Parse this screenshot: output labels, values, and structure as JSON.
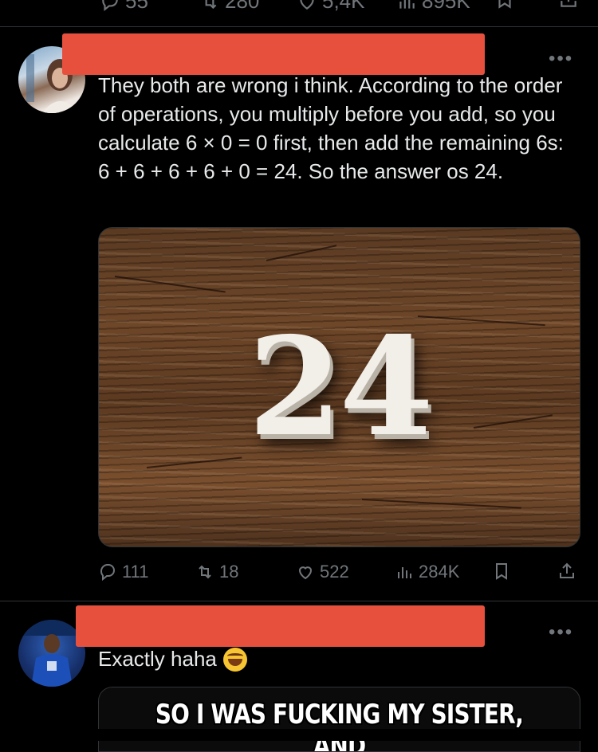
{
  "previous_tweet": {
    "actions": [
      {
        "icon": "reply-icon",
        "label": "55"
      },
      {
        "icon": "retweet-icon",
        "label": "280"
      },
      {
        "icon": "heart-icon",
        "label": "5,4K"
      },
      {
        "icon": "views-icon",
        "label": "895K"
      },
      {
        "icon": "bookmark-icon",
        "label": ""
      },
      {
        "icon": "share-icon",
        "label": ""
      }
    ]
  },
  "tweet": {
    "author_redacted": true,
    "more_label": "•••",
    "text": "They both are wrong i think. According to the order of operations, you multiply before you add, so you calculate 6 × 0 = 0 first, then add the remaining 6s: 6 + 6 + 6 + 6 + 0 = 24. So the answer os 24.",
    "image_number": "24",
    "actions": {
      "replies": "111",
      "retweets": "18",
      "likes": "522",
      "views": "284K"
    }
  },
  "reply": {
    "author_redacted": true,
    "more_label": "•••",
    "text": "Exactly haha",
    "emoji": "rolling-on-floor-laughing",
    "media_caption": "SO I WAS FUCKING MY SISTER, AND"
  },
  "colors": {
    "background": "#000000",
    "text": "#e7e9ea",
    "muted": "#71767b",
    "redaction": "#e8503e",
    "divider": "#2f3336"
  }
}
